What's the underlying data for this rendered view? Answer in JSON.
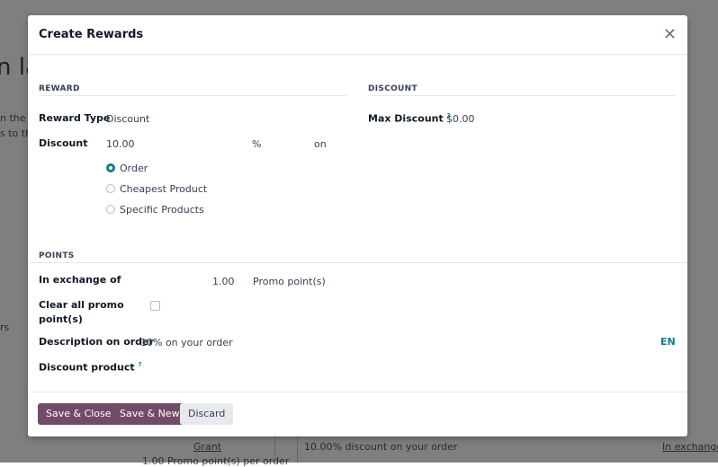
{
  "background": {
    "title_fragment": "n la",
    "text1": "n the c",
    "text2": "s to the",
    "text3": "rs",
    "grant": "Grant",
    "grant_detail": "1.00 Promo point(s) per order",
    "reward_desc": "10.00% discount on your order",
    "exchange": "In exchange o"
  },
  "modal": {
    "title": "Create Rewards",
    "reward_section": "REWARD",
    "discount_section": "DISCOUNT",
    "reward_type_label": "Reward Type",
    "reward_type_value": "Discount",
    "discount_label": "Discount",
    "discount_value": "10.00",
    "discount_unit": "%",
    "on_label": "on",
    "apply_options": [
      {
        "label": "Order",
        "selected": true
      },
      {
        "label": "Cheapest Product",
        "selected": false
      },
      {
        "label": "Specific Products",
        "selected": false
      }
    ],
    "max_discount_label": "Max Discount",
    "help_mark": "?",
    "max_discount_value": "$0.00",
    "points_section": "POINTS",
    "exchange_label": "In exchange of",
    "exchange_value": "1.00",
    "exchange_unit": "Promo point(s)",
    "clear_points_label_1": "Clear all promo",
    "clear_points_label_2": "point(s)",
    "clear_points_checked": false,
    "description_label": "Description on order",
    "description_value": "10% on your order",
    "lang": "EN",
    "discount_product_label": "Discount product",
    "buttons": {
      "save_close": "Save & Close",
      "save_new": "Save & New",
      "discard": "Discard"
    },
    "accent": "#714b67",
    "teal": "#0e7c86"
  }
}
